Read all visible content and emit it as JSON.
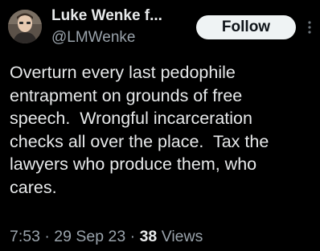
{
  "author": {
    "display_name": "Luke Wenke f...",
    "handle": "@LMWenke"
  },
  "actions": {
    "follow_label": "Follow",
    "more_icon": "more-vertical-icon"
  },
  "tweet": {
    "text_lines": [
      "Overturn every last pedophile",
      "entrapment on grounds of free",
      "speech.  Wrongful incarceration",
      "checks all over the place.  Tax the",
      "lawyers who produce them, who",
      "cares."
    ]
  },
  "meta": {
    "time": "7:53",
    "separator": "·",
    "date": "29 Sep 23",
    "views_count": "38",
    "views_label": "Views"
  },
  "colors": {
    "background": "#000000",
    "text_primary": "#e7e9ea",
    "text_secondary": "#9aa3ab",
    "follow_bg": "#eff3f4"
  }
}
